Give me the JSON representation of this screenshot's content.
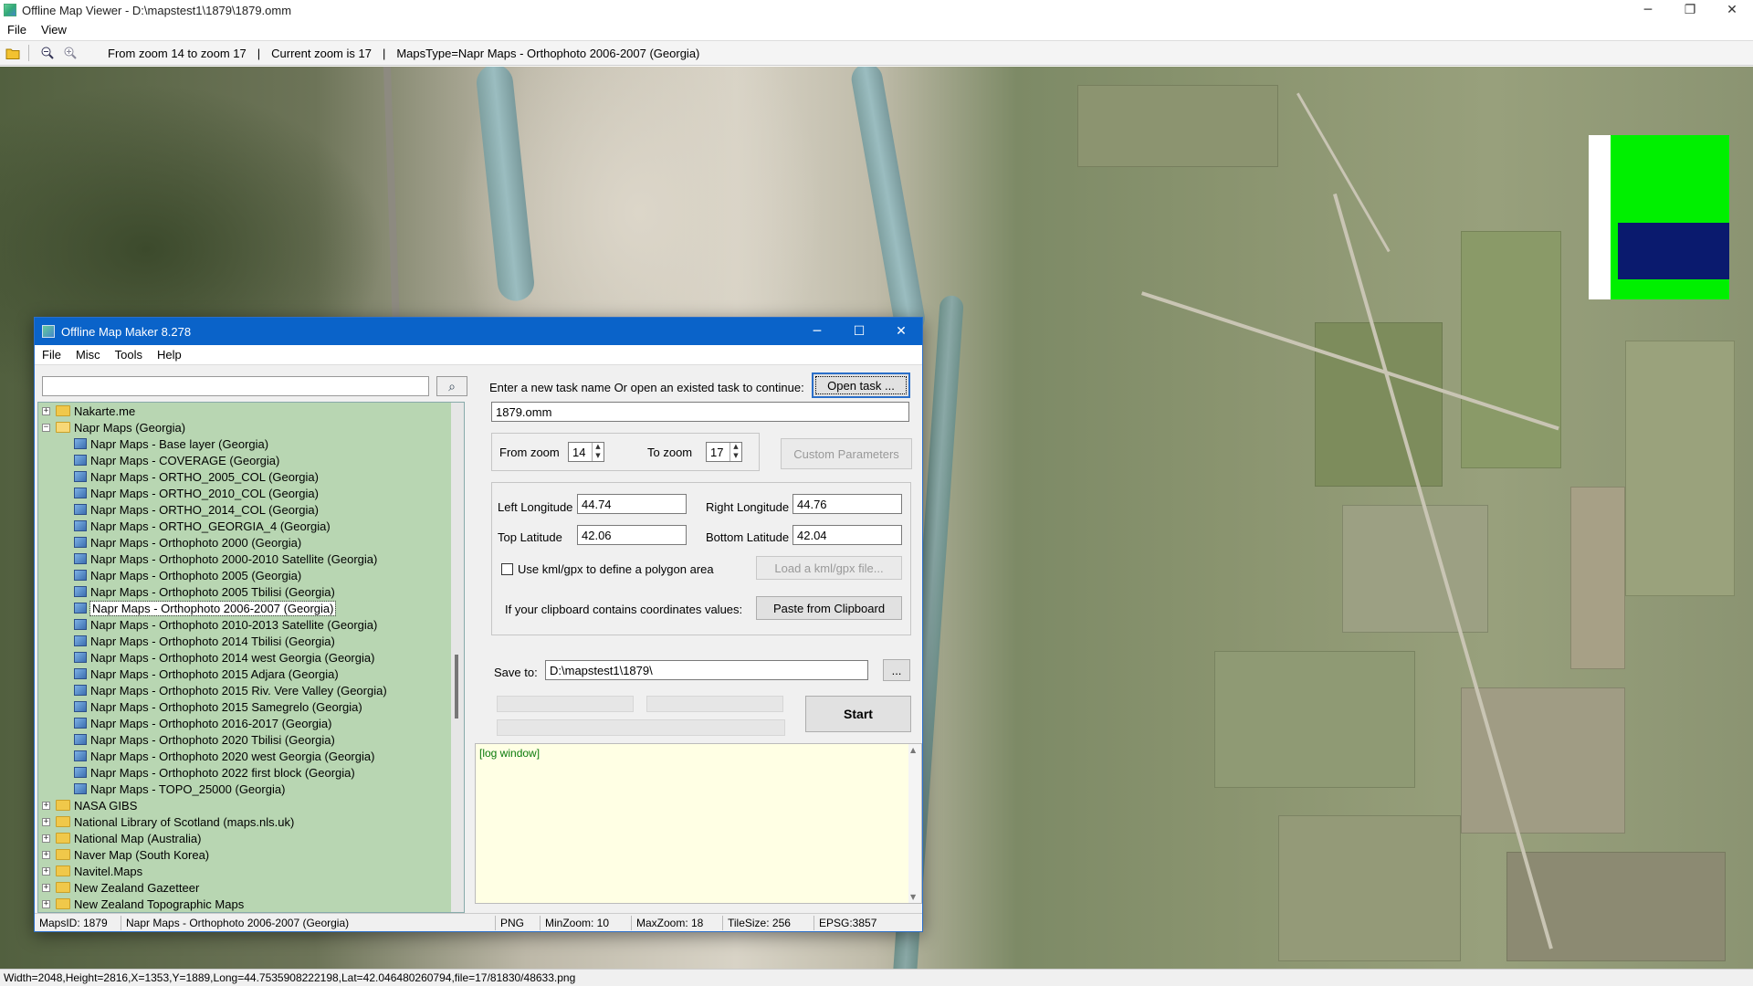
{
  "viewer": {
    "title": "Offline Map Viewer - D:\\mapstest1\\1879\\1879.omm",
    "menu": [
      "File",
      "View"
    ],
    "toolbar": {
      "zoom_range": "From zoom 14 to zoom 17",
      "sep1": "|",
      "current_zoom": "Current zoom is 17",
      "sep2": "|",
      "maps_type": "MapsType=Napr Maps - Orthophoto 2006-2007 (Georgia)"
    },
    "status": "Width=2048,Height=2816,X=1353,Y=1889,Long=44.7535908222198,Lat=42.046480260794,file=17/81830/48633.png",
    "window_controls": {
      "min": "─",
      "max": "❐",
      "close": "✕"
    }
  },
  "dialog": {
    "title": "Offline Map Maker 8.278",
    "controls": {
      "min": "─",
      "max": "☐",
      "close": "✕"
    },
    "menu": [
      "File",
      "Misc",
      "Tools",
      "Help"
    ],
    "search": {
      "value": "",
      "button_icon": "⌕"
    },
    "tree": [
      {
        "type": "folder",
        "label": "Nakarte.me",
        "expanded": false
      },
      {
        "type": "folder",
        "label": "Napr Maps (Georgia)",
        "expanded": true
      },
      {
        "type": "map",
        "label": "Napr Maps - Base layer (Georgia)"
      },
      {
        "type": "map",
        "label": "Napr Maps - COVERAGE (Georgia)"
      },
      {
        "type": "map",
        "label": "Napr Maps - ORTHO_2005_COL (Georgia)"
      },
      {
        "type": "map",
        "label": "Napr Maps - ORTHO_2010_COL (Georgia)"
      },
      {
        "type": "map",
        "label": "Napr Maps - ORTHO_2014_COL (Georgia)"
      },
      {
        "type": "map",
        "label": "Napr Maps - ORTHO_GEORGIA_4 (Georgia)"
      },
      {
        "type": "map",
        "label": "Napr Maps - Orthophoto 2000 (Georgia)"
      },
      {
        "type": "map",
        "label": "Napr Maps - Orthophoto 2000-2010 Satellite (Georgia)"
      },
      {
        "type": "map",
        "label": "Napr Maps - Orthophoto 2005 (Georgia)"
      },
      {
        "type": "map",
        "label": "Napr Maps - Orthophoto 2005 Tbilisi (Georgia)"
      },
      {
        "type": "map",
        "label": "Napr Maps - Orthophoto 2006-2007 (Georgia)",
        "selected": true
      },
      {
        "type": "map",
        "label": "Napr Maps - Orthophoto 2010-2013 Satellite (Georgia)"
      },
      {
        "type": "map",
        "label": "Napr Maps - Orthophoto 2014 Tbilisi (Georgia)"
      },
      {
        "type": "map",
        "label": "Napr Maps - Orthophoto 2014 west Georgia (Georgia)"
      },
      {
        "type": "map",
        "label": "Napr Maps - Orthophoto 2015 Adjara (Georgia)"
      },
      {
        "type": "map",
        "label": "Napr Maps - Orthophoto 2015 Riv. Vere Valley (Georgia)"
      },
      {
        "type": "map",
        "label": "Napr Maps - Orthophoto 2015 Samegrelo (Georgia)"
      },
      {
        "type": "map",
        "label": "Napr Maps - Orthophoto 2016-2017 (Georgia)"
      },
      {
        "type": "map",
        "label": "Napr Maps - Orthophoto 2020 Tbilisi (Georgia)"
      },
      {
        "type": "map",
        "label": "Napr Maps - Orthophoto 2020 west Georgia (Georgia)"
      },
      {
        "type": "map",
        "label": "Napr Maps - Orthophoto 2022 first block (Georgia)"
      },
      {
        "type": "map",
        "label": "Napr Maps - TOPO_25000 (Georgia)"
      },
      {
        "type": "folder",
        "label": "NASA GIBS",
        "expanded": false
      },
      {
        "type": "folder",
        "label": "National Library of Scotland (maps.nls.uk)",
        "expanded": false
      },
      {
        "type": "folder",
        "label": "National Map (Australia)",
        "expanded": false
      },
      {
        "type": "folder",
        "label": "Naver Map (South Korea)",
        "expanded": false
      },
      {
        "type": "folder",
        "label": "Navitel.Maps",
        "expanded": false
      },
      {
        "type": "folder",
        "label": "New Zealand Gazetteer",
        "expanded": false
      },
      {
        "type": "folder",
        "label": "New Zealand Topographic Maps",
        "expanded": false
      }
    ],
    "task": {
      "prompt": "Enter a new task name Or open an existed task to continue:",
      "open_button": "Open task ...",
      "name_value": "1879.omm"
    },
    "zoom": {
      "from_label": "From zoom",
      "from_value": "14",
      "to_label": "To zoom",
      "to_value": "17",
      "custom_button": "Custom Parameters"
    },
    "coords": {
      "left_lon_label": "Left Longitude",
      "left_lon_value": "44.74",
      "right_lon_label": "Right Longitude",
      "right_lon_value": "44.76",
      "top_lat_label": "Top Latitude",
      "top_lat_value": "42.06",
      "bottom_lat_label": "Bottom Latitude",
      "bottom_lat_value": "42.04",
      "kml_checkbox_label": "Use kml/gpx to define a polygon area",
      "kml_checked": false,
      "load_kml_button": "Load a kml/gpx file...",
      "clipboard_label": "If your clipboard contains coordinates values:",
      "paste_button": "Paste from Clipboard"
    },
    "save": {
      "label": "Save to:",
      "path": "D:\\mapstest1\\1879\\",
      "browse_button": "...",
      "start_button": "Start"
    },
    "log": {
      "text": "[log window]"
    },
    "status": {
      "maps_id": "MapsID: 1879",
      "map_name": "Napr Maps - Orthophoto 2006-2007 (Georgia)",
      "format": "PNG",
      "min_zoom": "MinZoom: 10",
      "max_zoom": "MaxZoom: 18",
      "tile_size": "TileSize: 256",
      "epsg": "EPSG:3857"
    }
  }
}
